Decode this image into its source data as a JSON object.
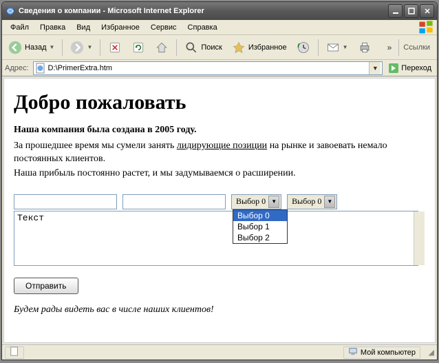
{
  "titlebar": {
    "text": "Сведения о компании - Microsoft Internet Explorer"
  },
  "menu": {
    "file": "Файл",
    "edit": "Правка",
    "view": "Вид",
    "favorites": "Избранное",
    "tools": "Сервис",
    "help": "Справка"
  },
  "toolbar": {
    "back": "Назад",
    "search": "Поиск",
    "favorites": "Избранное",
    "links": "Ссылки"
  },
  "address": {
    "label": "Адрес:",
    "value": "D:\\PrimerExtra.htm",
    "go": "Переход"
  },
  "page": {
    "heading": "Добро пожаловать",
    "bold_line": "Наша компания была создана в 2005 году.",
    "p1a": "За прошедшее время мы сумели занять ",
    "p1_link": "лидирующие позиции",
    "p1b": " на рынке и завоевать немало постоянных клиентов.",
    "p2": "Наша прибыль постоянно растет, и мы задумываемся о расширении.",
    "select1": "Выбор 0",
    "select2": "Выбор 0",
    "options": {
      "o0": "Выбор 0",
      "o1": "Выбор 1",
      "o2": "Выбор 2"
    },
    "textarea": "Текст",
    "submit": "Отправить",
    "footer": "Будем рады видеть вас в числе наших клиентов!"
  },
  "status": {
    "zone": "Мой компьютер"
  }
}
